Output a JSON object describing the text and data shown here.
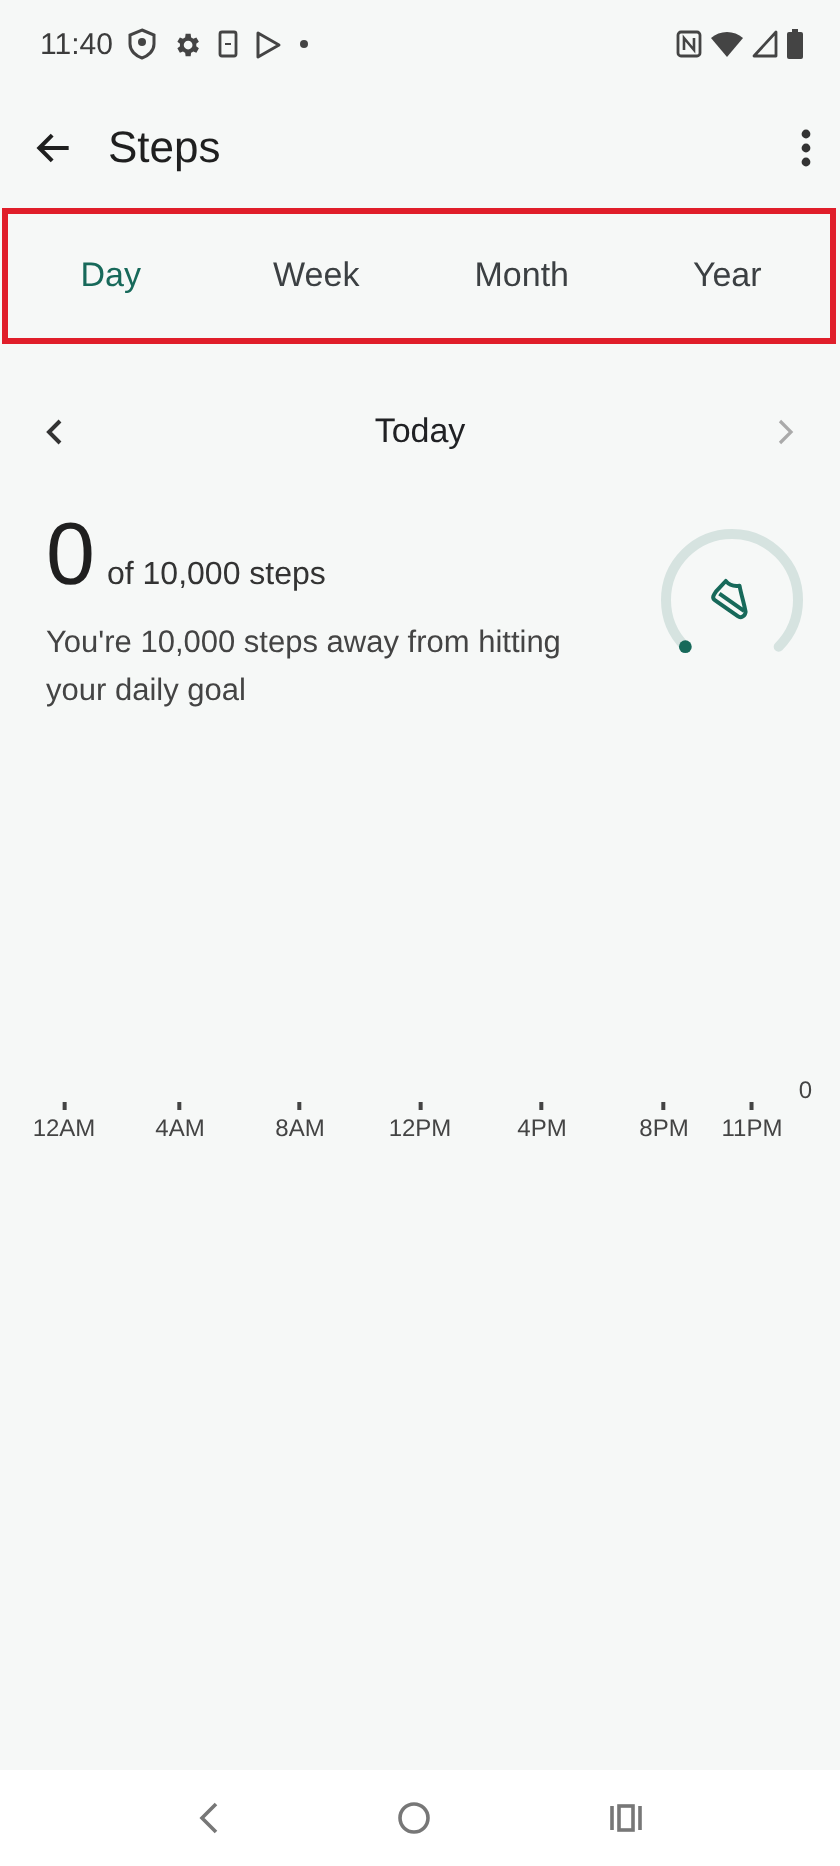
{
  "status_bar": {
    "time": "11:40"
  },
  "app_bar": {
    "title": "Steps"
  },
  "tab_bar": {
    "highlighted": true,
    "tabs": [
      {
        "label": "Day",
        "selected": true
      },
      {
        "label": "Week",
        "selected": false
      },
      {
        "label": "Month",
        "selected": false
      },
      {
        "label": "Year",
        "selected": false
      }
    ]
  },
  "date_nav": {
    "label": "Today",
    "next_disabled": true
  },
  "summary": {
    "count": "0",
    "goal": "of 10,000 steps",
    "message": "You're 10,000 steps away from hitting your daily goal"
  },
  "chart": {
    "x_labels": [
      "12AM",
      "4AM",
      "8AM",
      "12PM",
      "4PM",
      "8PM",
      "11PM"
    ],
    "y_label": "0"
  }
}
